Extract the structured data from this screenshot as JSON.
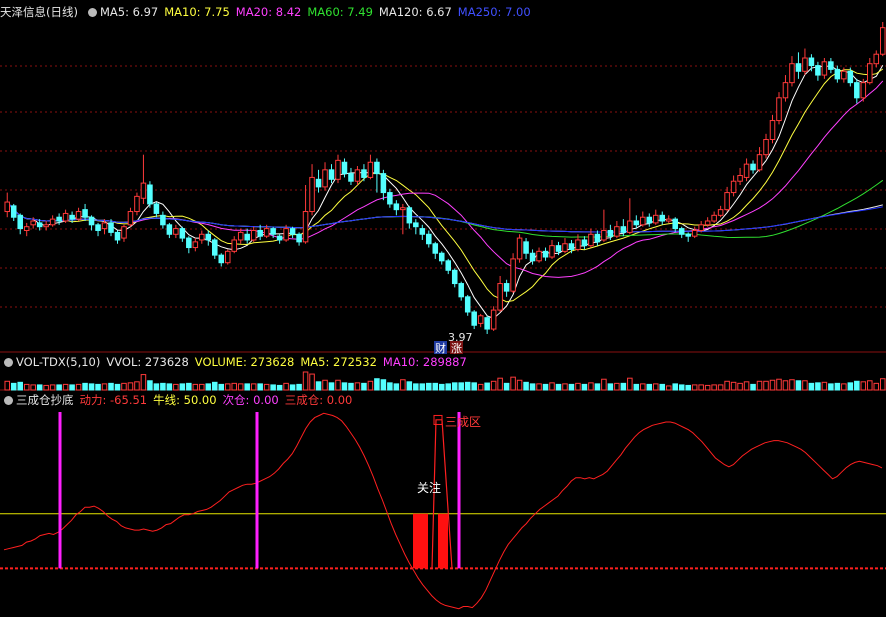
{
  "main": {
    "title": "天泽信息(日线)",
    "ma5": "MA5: 6.97",
    "ma10": "MA10: 7.75",
    "ma20": "MA20: 8.42",
    "ma60": "MA60: 7.49",
    "ma120": "MA120: 6.67",
    "ma250": "MA250: 7.00",
    "low_label": "3.97",
    "marker1": "财",
    "marker2": "涨"
  },
  "volume": {
    "title": "VOL-TDX(5,10)",
    "vvol": "VVOL: 273628",
    "volume": "VOLUME: 273628",
    "ma5": "MA5: 272532",
    "ma10": "MA10: 289887"
  },
  "indicator": {
    "title": "三成仓抄底",
    "dongli": "动力: -65.51",
    "niuxian": "牛线: 50.00",
    "cicang": "次仓: 0.00",
    "sanchengcang": "三成仓: 0.00",
    "label_guanzhu": "关注",
    "label_sanchengqu": "三成区"
  },
  "colors": {
    "up": "#ff3a3a",
    "down": "#54ffff",
    "ma5": "#ffffff",
    "ma10": "#ffff40",
    "ma20": "#ff40ff",
    "ma60": "#30e030",
    "ma120": "#e6e6e6",
    "ma250": "#2030ff",
    "grid": "#8a1010"
  },
  "chart_data": {
    "type": "candlestick",
    "price_range": [
      3.6,
      12.2
    ],
    "candles": [
      [
        7.2,
        7.45,
        7.7,
        7.05
      ],
      [
        7.35,
        7.05,
        7.4,
        6.95
      ],
      [
        7.1,
        6.75,
        7.15,
        6.6
      ],
      [
        6.7,
        6.8,
        6.9,
        6.55
      ],
      [
        6.85,
        6.95,
        7.05,
        6.75
      ],
      [
        6.9,
        6.8,
        7.0,
        6.7
      ],
      [
        6.8,
        6.85,
        6.95,
        6.7
      ],
      [
        6.85,
        7.0,
        7.1,
        6.8
      ],
      [
        7.05,
        6.95,
        7.15,
        6.85
      ],
      [
        6.95,
        7.15,
        7.25,
        6.9
      ],
      [
        7.1,
        7.0,
        7.2,
        6.9
      ],
      [
        7.0,
        7.2,
        7.3,
        6.95
      ],
      [
        7.25,
        7.05,
        7.4,
        6.95
      ],
      [
        7.05,
        6.85,
        7.1,
        6.7
      ],
      [
        6.85,
        6.7,
        6.9,
        6.55
      ],
      [
        6.75,
        6.9,
        7.0,
        6.6
      ],
      [
        6.9,
        6.65,
        7.0,
        6.55
      ],
      [
        6.65,
        6.45,
        6.7,
        6.35
      ],
      [
        6.5,
        6.8,
        6.85,
        6.4
      ],
      [
        6.85,
        7.2,
        7.3,
        6.8
      ],
      [
        7.2,
        7.6,
        7.7,
        7.1
      ],
      [
        7.55,
        7.95,
        8.7,
        7.4
      ],
      [
        7.9,
        7.4,
        8.0,
        7.3
      ],
      [
        7.4,
        7.15,
        7.45,
        7.05
      ],
      [
        7.1,
        6.85,
        7.2,
        6.75
      ],
      [
        6.85,
        6.6,
        6.9,
        6.5
      ],
      [
        6.6,
        6.75,
        6.85,
        6.5
      ],
      [
        6.75,
        6.5,
        6.8,
        6.4
      ],
      [
        6.5,
        6.25,
        6.55,
        6.1
      ],
      [
        6.25,
        6.4,
        6.5,
        6.15
      ],
      [
        6.45,
        6.6,
        6.7,
        6.35
      ],
      [
        6.6,
        6.45,
        6.7,
        6.3
      ],
      [
        6.45,
        6.05,
        6.5,
        5.95
      ],
      [
        6.05,
        5.85,
        6.1,
        5.75
      ],
      [
        5.85,
        6.15,
        6.2,
        5.8
      ],
      [
        6.15,
        6.45,
        6.55,
        6.1
      ],
      [
        6.45,
        6.65,
        6.75,
        6.35
      ],
      [
        6.6,
        6.45,
        6.75,
        6.35
      ],
      [
        6.45,
        6.7,
        6.8,
        6.4
      ],
      [
        6.7,
        6.55,
        6.85,
        6.45
      ],
      [
        6.55,
        6.75,
        6.85,
        6.5
      ],
      [
        6.75,
        6.6,
        6.8,
        6.5
      ],
      [
        6.55,
        6.45,
        6.6,
        6.35
      ],
      [
        6.45,
        6.75,
        6.85,
        6.4
      ],
      [
        6.75,
        6.6,
        6.8,
        6.5
      ],
      [
        6.6,
        6.4,
        6.65,
        6.3
      ],
      [
        6.4,
        7.2,
        7.9,
        6.35
      ],
      [
        7.2,
        8.1,
        8.45,
        7.1
      ],
      [
        8.05,
        7.85,
        8.3,
        7.7
      ],
      [
        7.85,
        8.3,
        8.5,
        7.75
      ],
      [
        8.3,
        8.05,
        8.45,
        7.95
      ],
      [
        8.05,
        8.55,
        8.7,
        7.95
      ],
      [
        8.5,
        8.2,
        8.6,
        8.1
      ],
      [
        8.2,
        8.0,
        8.35,
        7.9
      ],
      [
        8.0,
        8.3,
        8.4,
        7.9
      ],
      [
        8.3,
        8.1,
        8.45,
        8.0
      ],
      [
        8.1,
        8.5,
        8.7,
        8.05
      ],
      [
        8.5,
        8.2,
        8.6,
        7.7
      ],
      [
        8.2,
        7.7,
        8.3,
        7.5
      ],
      [
        7.7,
        7.4,
        7.8,
        7.3
      ],
      [
        7.4,
        7.25,
        7.5,
        7.1
      ],
      [
        7.25,
        7.3,
        7.4,
        6.6
      ],
      [
        7.3,
        6.9,
        7.35,
        6.75
      ],
      [
        6.9,
        6.8,
        7.0,
        6.6
      ],
      [
        6.75,
        6.6,
        6.85,
        6.45
      ],
      [
        6.6,
        6.35,
        6.7,
        6.25
      ],
      [
        6.35,
        6.1,
        6.4,
        5.95
      ],
      [
        6.1,
        5.9,
        6.15,
        5.8
      ],
      [
        5.9,
        5.65,
        5.95,
        5.55
      ],
      [
        5.65,
        5.3,
        5.7,
        5.2
      ],
      [
        5.3,
        4.95,
        5.35,
        4.85
      ],
      [
        4.95,
        4.55,
        5.0,
        4.45
      ],
      [
        4.55,
        4.2,
        4.6,
        4.1
      ],
      [
        4.25,
        4.45,
        4.5,
        4.15
      ],
      [
        4.4,
        4.1,
        4.45,
        3.97
      ],
      [
        4.1,
        4.6,
        4.7,
        4.05
      ],
      [
        4.6,
        5.3,
        5.5,
        4.55
      ],
      [
        5.3,
        5.1,
        5.4,
        4.95
      ],
      [
        5.1,
        5.95,
        6.1,
        5.05
      ],
      [
        5.95,
        6.5,
        6.6,
        5.85
      ],
      [
        6.4,
        6.1,
        6.5,
        5.95
      ],
      [
        6.1,
        5.9,
        6.2,
        5.8
      ],
      [
        5.9,
        6.15,
        6.25,
        5.85
      ],
      [
        6.15,
        6.0,
        6.25,
        5.9
      ],
      [
        6.0,
        6.3,
        6.45,
        5.95
      ],
      [
        6.3,
        6.15,
        6.4,
        6.05
      ],
      [
        6.15,
        6.35,
        6.5,
        6.1
      ],
      [
        6.35,
        6.2,
        6.45,
        6.1
      ],
      [
        6.2,
        6.45,
        6.6,
        6.15
      ],
      [
        6.45,
        6.3,
        6.55,
        6.2
      ],
      [
        6.3,
        6.6,
        6.75,
        6.25
      ],
      [
        6.6,
        6.4,
        6.7,
        6.3
      ],
      [
        6.45,
        6.7,
        7.25,
        6.4
      ],
      [
        6.7,
        6.55,
        6.85,
        6.45
      ],
      [
        6.55,
        6.8,
        6.95,
        6.5
      ],
      [
        6.8,
        6.65,
        7.0,
        6.55
      ],
      [
        6.65,
        6.95,
        7.55,
        6.6
      ],
      [
        6.95,
        6.85,
        7.1,
        6.75
      ],
      [
        6.85,
        7.05,
        7.2,
        6.8
      ],
      [
        7.05,
        6.9,
        7.15,
        6.8
      ],
      [
        6.9,
        7.1,
        7.25,
        6.85
      ],
      [
        7.1,
        6.95,
        7.2,
        6.85
      ],
      [
        6.95,
        7.0,
        7.1,
        6.9
      ],
      [
        7.0,
        6.75,
        7.05,
        6.65
      ],
      [
        6.75,
        6.6,
        6.8,
        6.5
      ],
      [
        6.6,
        6.55,
        6.65,
        6.4
      ],
      [
        6.55,
        6.7,
        6.8,
        6.5
      ],
      [
        6.7,
        6.85,
        6.95,
        6.65
      ],
      [
        6.85,
        6.95,
        7.05,
        6.8
      ],
      [
        6.95,
        7.1,
        7.2,
        6.9
      ],
      [
        7.1,
        7.25,
        7.35,
        7.05
      ],
      [
        7.25,
        7.7,
        7.85,
        7.2
      ],
      [
        7.7,
        8.0,
        8.15,
        7.6
      ],
      [
        8.0,
        8.15,
        8.35,
        7.9
      ],
      [
        8.1,
        8.45,
        8.6,
        8.0
      ],
      [
        8.45,
        8.3,
        8.55,
        8.2
      ],
      [
        8.3,
        8.7,
        8.9,
        8.25
      ],
      [
        8.7,
        9.1,
        9.25,
        8.6
      ],
      [
        9.1,
        9.6,
        9.75,
        9.0
      ],
      [
        9.6,
        10.2,
        10.35,
        9.5
      ],
      [
        10.2,
        10.6,
        10.8,
        10.1
      ],
      [
        10.6,
        11.1,
        11.3,
        10.5
      ],
      [
        11.1,
        10.9,
        11.4,
        10.7
      ],
      [
        10.9,
        11.25,
        11.5,
        10.8
      ],
      [
        11.25,
        11.05,
        11.35,
        10.9
      ],
      [
        11.05,
        10.8,
        11.15,
        10.65
      ],
      [
        10.8,
        11.15,
        11.25,
        10.7
      ],
      [
        11.15,
        10.95,
        11.25,
        10.85
      ],
      [
        10.95,
        10.7,
        11.05,
        10.6
      ],
      [
        10.7,
        10.9,
        11.0,
        10.6
      ],
      [
        10.9,
        10.6,
        11.0,
        10.5
      ],
      [
        10.6,
        10.2,
        10.7,
        10.05
      ],
      [
        10.2,
        10.6,
        10.7,
        10.1
      ],
      [
        10.6,
        11.1,
        11.25,
        10.55
      ],
      [
        11.1,
        11.35,
        11.45,
        11.0
      ],
      [
        11.35,
        12.05,
        12.2,
        11.3
      ]
    ],
    "volume_labels": {
      "vvol": 273628,
      "volume": 273628,
      "ma5": 272532,
      "ma10": 289887
    },
    "indicator": {
      "range": [
        -40,
        145
      ],
      "niuxian": 50,
      "dongli": [
        17,
        18,
        19,
        20,
        21,
        24,
        25,
        27,
        30,
        31,
        32,
        31,
        33,
        36,
        40,
        44,
        49,
        52,
        56,
        56,
        57,
        55,
        52,
        48,
        45,
        43,
        39,
        37,
        36,
        35,
        35,
        36,
        35,
        34,
        35,
        37,
        40,
        41,
        44,
        47,
        49,
        49,
        50,
        52,
        53,
        54,
        56,
        59,
        62,
        66,
        70,
        72,
        74,
        76,
        77,
        77,
        78,
        80,
        82,
        84,
        87,
        91,
        96,
        100,
        105,
        112,
        120,
        128,
        134,
        138,
        140,
        142,
        141,
        140,
        138,
        135,
        130,
        124,
        118,
        111,
        103,
        94,
        84,
        73,
        63,
        52,
        41,
        31,
        22,
        13,
        5,
        -2,
        -9,
        -15,
        -20,
        -25,
        -29,
        -32,
        -34,
        -35,
        -36,
        -37,
        -35,
        -35,
        -36,
        -32,
        -27,
        -20,
        -11,
        -2,
        7,
        15,
        22,
        27,
        32,
        37,
        41,
        46,
        50,
        54,
        57,
        60,
        63,
        66,
        71,
        75,
        80,
        83,
        83,
        82,
        83,
        82,
        84,
        86,
        89,
        94,
        99,
        104,
        110,
        115,
        120,
        124,
        127,
        129,
        131,
        132,
        133,
        134,
        134,
        133,
        131,
        129,
        127,
        124,
        120,
        116,
        111,
        106,
        101,
        98,
        95,
        93,
        95,
        99,
        103,
        106,
        109,
        111,
        113,
        115,
        116,
        117,
        117,
        116,
        115,
        113,
        111,
        109,
        106,
        102,
        98,
        94,
        90,
        86,
        82,
        84,
        88,
        92,
        95,
        97,
        98,
        97,
        96,
        95,
        94,
        92
      ],
      "sanchengcang_bars": [
        [
          413,
          428
        ],
        [
          438,
          448
        ]
      ],
      "cicang_vlines": [
        60,
        257,
        459
      ]
    }
  }
}
